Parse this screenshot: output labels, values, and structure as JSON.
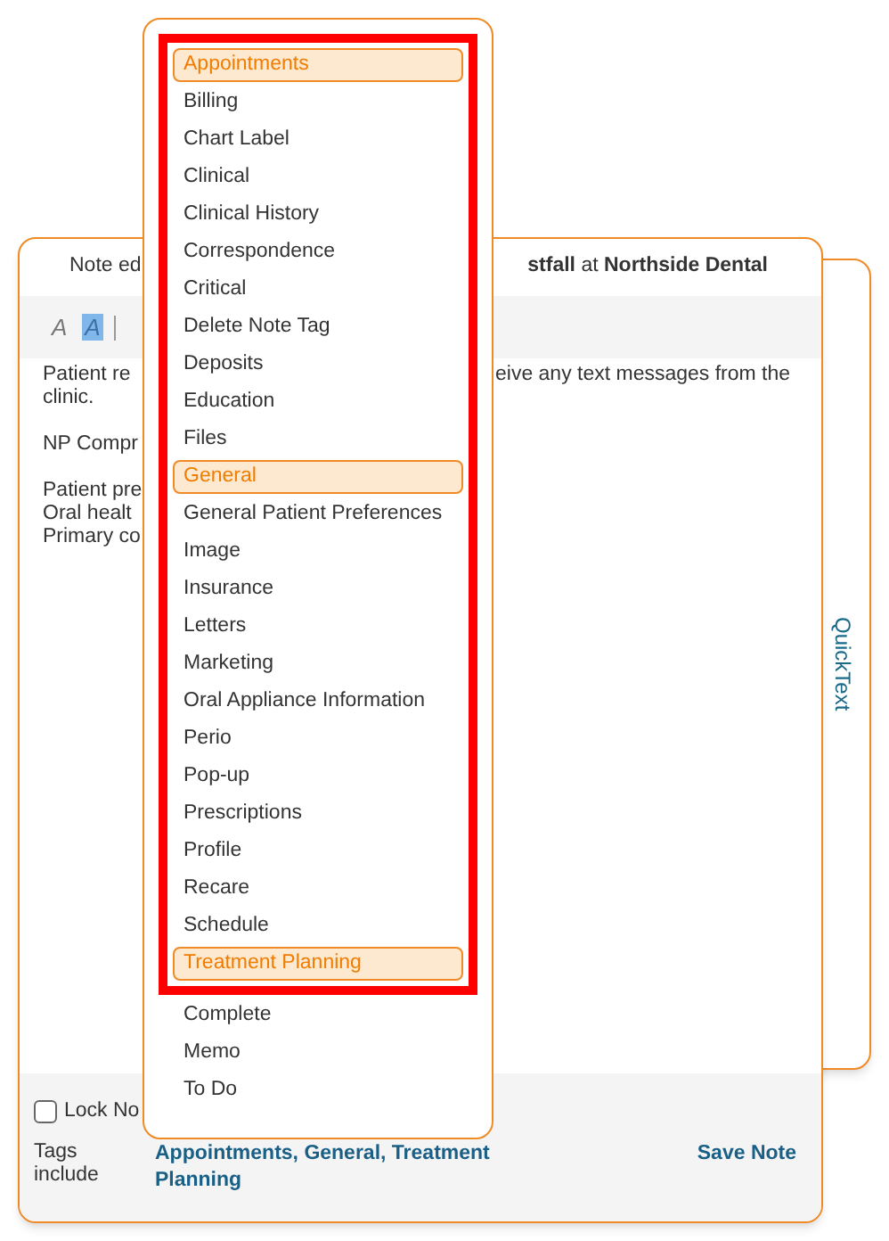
{
  "quicktext_panel": {
    "label": "QuickText"
  },
  "note_window": {
    "header_left": "Note ed",
    "header_right": "**stfall** at **Northside Dental**",
    "toolbar": [
      {
        "kind": "italic",
        "label": "A",
        "selected": false
      },
      {
        "kind": "italic",
        "label": "A",
        "selected": true
      }
    ],
    "paragraphs": [
      [
        {
          "left": "Patient re",
          "right": "eive any text messages from the"
        },
        {
          "left": "clinic."
        }
      ],
      [
        {
          "left": "NP Compr"
        }
      ],
      [
        {
          "left": "Patient pre"
        },
        {
          "left": "Oral healt"
        },
        {
          "left": "Primary co"
        }
      ]
    ],
    "lock": {
      "label": "Lock No",
      "checked": false
    },
    "tags_label": "Tags include",
    "tags_value": "Appointments, General, Treatment Planning",
    "save_button": "Save Note"
  },
  "tag_menu": {
    "framed_items": [
      {
        "label": "Appointments",
        "selected": true
      },
      {
        "label": "Billing",
        "selected": false
      },
      {
        "label": "Chart Label",
        "selected": false
      },
      {
        "label": "Clinical",
        "selected": false
      },
      {
        "label": "Clinical History",
        "selected": false
      },
      {
        "label": "Correspondence",
        "selected": false
      },
      {
        "label": "Critical",
        "selected": false
      },
      {
        "label": "Delete Note Tag",
        "selected": false
      },
      {
        "label": "Deposits",
        "selected": false
      },
      {
        "label": "Education",
        "selected": false
      },
      {
        "label": "Files",
        "selected": false
      },
      {
        "label": "General",
        "selected": true
      },
      {
        "label": "General Patient Preferences",
        "selected": false
      },
      {
        "label": "Image",
        "selected": false
      },
      {
        "label": "Insurance",
        "selected": false
      },
      {
        "label": "Letters",
        "selected": false
      },
      {
        "label": "Marketing",
        "selected": false
      },
      {
        "label": "Oral Appliance Information",
        "selected": false
      },
      {
        "label": "Perio",
        "selected": false
      },
      {
        "label": "Pop-up",
        "selected": false
      },
      {
        "label": "Prescriptions",
        "selected": false
      },
      {
        "label": "Profile",
        "selected": false
      },
      {
        "label": "Recare",
        "selected": false
      },
      {
        "label": "Schedule",
        "selected": false
      },
      {
        "label": "Treatment Planning",
        "selected": true
      }
    ],
    "items": [
      {
        "label": "Complete",
        "selected": false
      },
      {
        "label": "Memo",
        "selected": false
      },
      {
        "label": "To Do",
        "selected": false
      }
    ]
  }
}
